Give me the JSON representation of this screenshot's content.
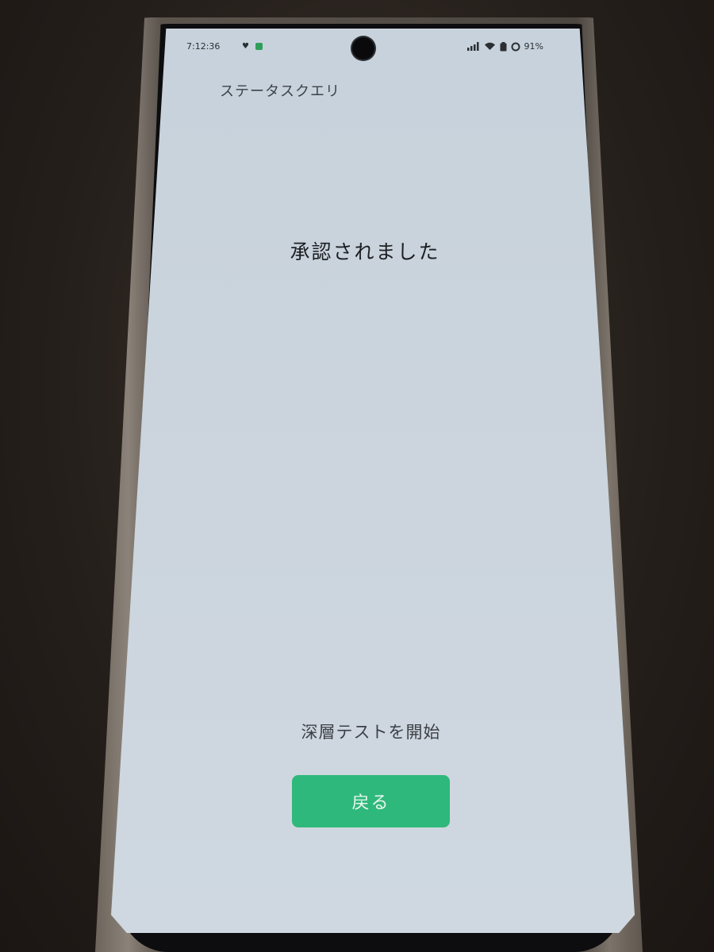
{
  "status_bar": {
    "time": "7:12:36",
    "battery_percent": "91%",
    "icons": [
      "notification-icon",
      "app-icon",
      "signal-icon",
      "wifi-icon",
      "battery-icon"
    ]
  },
  "app": {
    "title": "ステータスクエリ"
  },
  "main": {
    "headline": "承認されました",
    "deep_test_link": "深層テストを開始",
    "back_button": "戻る"
  },
  "colors": {
    "accent_button": "#2fb87b",
    "screen_background": "#cbd4dd",
    "text_primary": "#1c1f22"
  }
}
